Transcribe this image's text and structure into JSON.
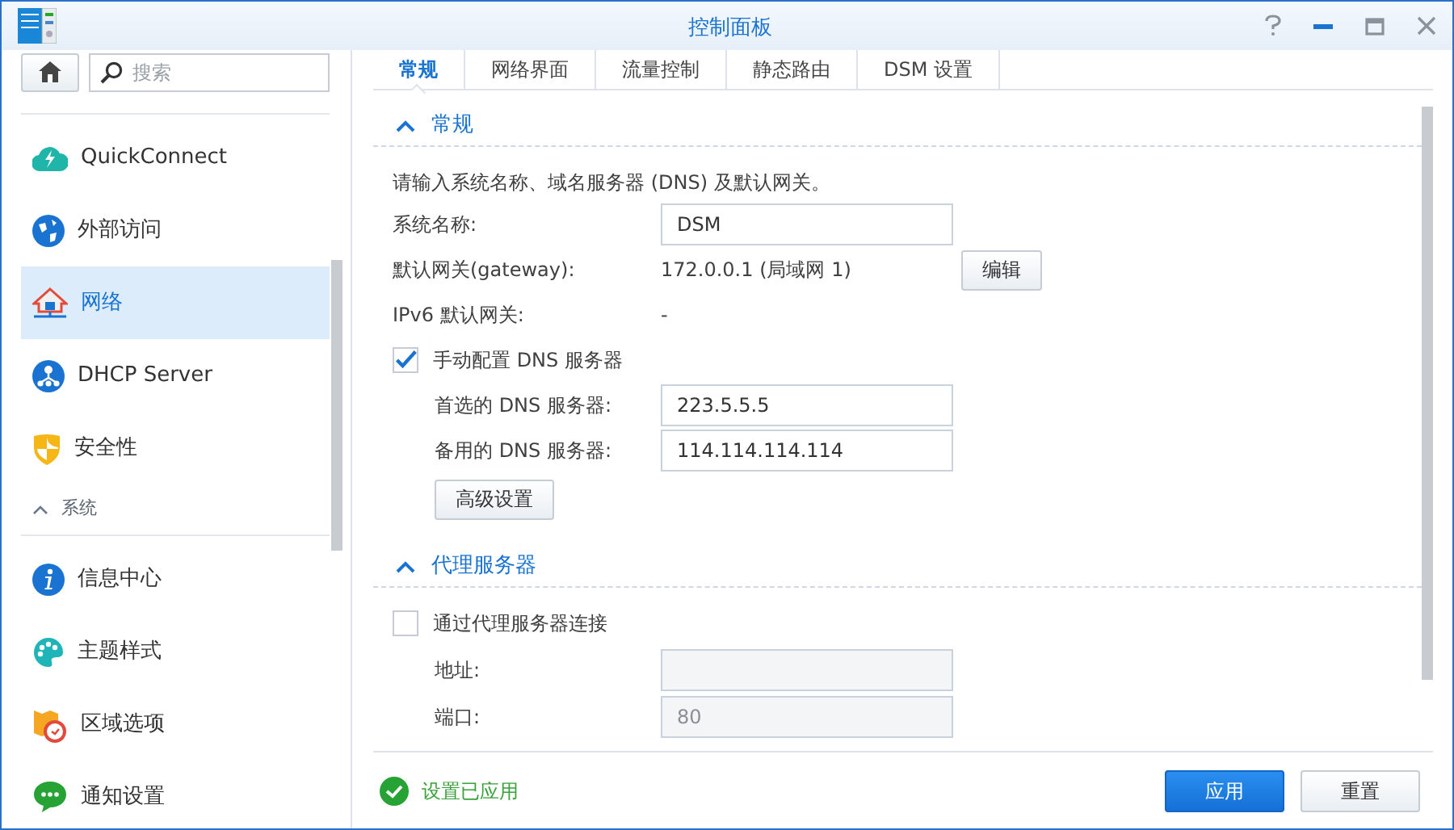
{
  "window": {
    "title": "控制面板"
  },
  "sidebar": {
    "search": {
      "placeholder": "搜索"
    },
    "items": [
      {
        "kind": "item",
        "label": "QuickConnect",
        "selected": false
      },
      {
        "kind": "item",
        "label": "外部访问",
        "selected": false
      },
      {
        "kind": "item",
        "label": "网络",
        "selected": true
      },
      {
        "kind": "item",
        "label": "DHCP Server",
        "selected": false
      },
      {
        "kind": "item",
        "label": "安全性",
        "selected": false
      },
      {
        "kind": "header",
        "label": "系统",
        "expanded": true
      },
      {
        "kind": "item",
        "label": "信息中心",
        "selected": false
      },
      {
        "kind": "item",
        "label": "主题样式",
        "selected": false
      },
      {
        "kind": "item",
        "label": "区域选项",
        "selected": false
      },
      {
        "kind": "item",
        "label": "通知设置",
        "selected": false
      }
    ]
  },
  "tabs": [
    {
      "label": "常规",
      "selected": true
    },
    {
      "label": "网络界面",
      "selected": false
    },
    {
      "label": "流量控制",
      "selected": false
    },
    {
      "label": "静态路由",
      "selected": false
    },
    {
      "label": "DSM 设置",
      "selected": false
    }
  ],
  "general": {
    "title": "常规",
    "expanded": true,
    "description": "请输入系统名称、域名服务器 (DNS) 及默认网关。",
    "system_name": {
      "label": "系统名称:",
      "value": "DSM"
    },
    "gateway": {
      "label": "默认网关(gateway):",
      "value": "172.0.0.1 (局域网 1)",
      "button": "编辑"
    },
    "ipv6_gateway": {
      "label": "IPv6 默认网关:",
      "value": "-"
    },
    "manual_dns": {
      "label": "手动配置 DNS 服务器",
      "checked": true
    },
    "preferred_dns": {
      "label": "首选的 DNS 服务器:",
      "value": "223.5.5.5"
    },
    "alternate_dns": {
      "label": "备用的 DNS 服务器:",
      "value": "114.114.114.114"
    },
    "advanced_button": "高级设置"
  },
  "proxy": {
    "title": "代理服务器",
    "expanded": true,
    "use_proxy": {
      "label": "通过代理服务器连接",
      "checked": false
    },
    "address": {
      "label": "地址:",
      "disabled": true
    },
    "port": {
      "label": "端口:",
      "value": "80",
      "disabled": true
    }
  },
  "footer": {
    "status": "设置已应用",
    "buttons": [
      {
        "label": "应用",
        "kind": "primary"
      },
      {
        "label": "重置",
        "kind": "secondary"
      }
    ]
  }
}
